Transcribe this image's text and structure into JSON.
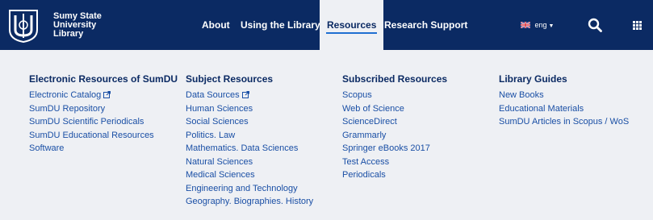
{
  "brand": {
    "lines": [
      "Sumy State",
      "University",
      "Library"
    ],
    "logo": "ssu-library-logo"
  },
  "nav": {
    "items": [
      {
        "label": "About"
      },
      {
        "label": "Using the Library"
      },
      {
        "label": "Resources",
        "active": true
      },
      {
        "label": "Research Support"
      }
    ],
    "language": {
      "label": "eng",
      "flag": "uk-flag-icon"
    },
    "search_icon": "search-icon",
    "apps_icon": "grid-icon"
  },
  "colors": {
    "topbar": "#0b2a63",
    "panel": "#eef0f4",
    "link": "#1a4fa5",
    "heading": "#0b2a63",
    "active_underline": "#1f6fd1"
  },
  "menu": {
    "columns": [
      {
        "title": "Electronic Resources of SumDU",
        "links": [
          {
            "label": "Electronic Catalog",
            "external": true
          },
          {
            "label": "SumDU Repository"
          },
          {
            "label": "SumDU Scientific Periodicals"
          },
          {
            "label": "SumDU Educational Resources"
          },
          {
            "label": "Software"
          }
        ]
      },
      {
        "title": "Subject Resources",
        "links": [
          {
            "label": "Data Sources",
            "external": true
          },
          {
            "label": "Human Sciences"
          },
          {
            "label": "Social Sciences"
          },
          {
            "label": "Politics. Law"
          },
          {
            "label": "Mathematics. Data Sciences"
          },
          {
            "label": "Natural Sciences"
          },
          {
            "label": "Medical Sciences"
          },
          {
            "label": "Engineering and Technology"
          },
          {
            "label": "Geography. Biographies. History"
          }
        ]
      },
      {
        "title": "Subscribed Resources",
        "links": [
          {
            "label": "Scopus"
          },
          {
            "label": "Web of Science"
          },
          {
            "label": "ScienceDirect"
          },
          {
            "label": "Grammarly"
          },
          {
            "label": "Springer eBooks 2017"
          },
          {
            "label": "Test Access"
          },
          {
            "label": "Periodicals"
          }
        ]
      },
      {
        "title": "Library Guides",
        "links": [
          {
            "label": "New Books"
          },
          {
            "label": "Educational Materials"
          },
          {
            "label": "SumDU Articles in Scopus / WoS"
          }
        ]
      }
    ]
  }
}
